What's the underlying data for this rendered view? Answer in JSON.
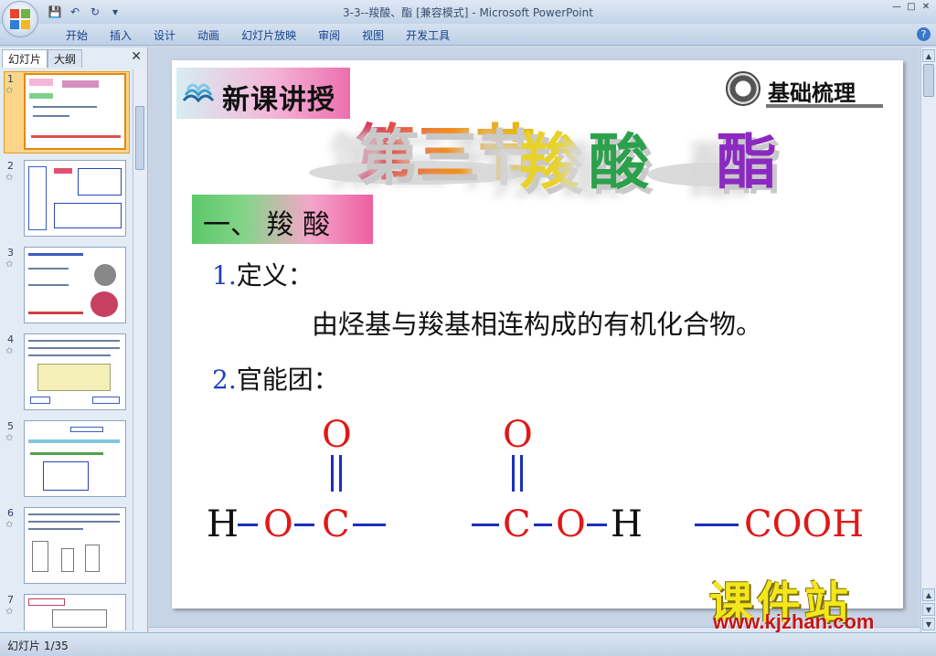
{
  "window": {
    "title": "3-3--羧酸、酯 [兼容模式] - Microsoft PowerPoint"
  },
  "ribbon": {
    "tabs": [
      "开始",
      "插入",
      "设计",
      "动画",
      "幻灯片放映",
      "审阅",
      "视图",
      "开发工具"
    ]
  },
  "left_panel": {
    "tabs": [
      "幻灯片",
      "大纲"
    ],
    "active_tab": "幻灯片",
    "slide_numbers": [
      "1",
      "2",
      "3",
      "4",
      "5",
      "6",
      "7"
    ],
    "selected_slide": "1"
  },
  "slide": {
    "tag_left": "新课讲授",
    "tag_right": "基础梳理",
    "title_chars": [
      "第三节",
      "羧",
      "酸",
      "酯"
    ],
    "section": "一、 羧 酸",
    "item1_num": "1.",
    "item1_label": "定义：",
    "item1_body": "由烃基与羧基相连构成的有机化合物。",
    "item2_num": "2.",
    "item2_label": "官能团：",
    "formula1": {
      "H": "H",
      "O": "O",
      "C": "C",
      "top_O": "O"
    },
    "formula2": {
      "C": "C",
      "O": "O",
      "H": "H",
      "top_O": "O"
    },
    "formula3": "COOH",
    "colors": {
      "red": "#e01818",
      "blue": "#1b2fbf",
      "number_blue": "#1b3fbf"
    }
  },
  "watermark": {
    "text": "课件站",
    "url": "www.kjzhan.com"
  },
  "status": {
    "text": "幻灯片 1/35"
  }
}
